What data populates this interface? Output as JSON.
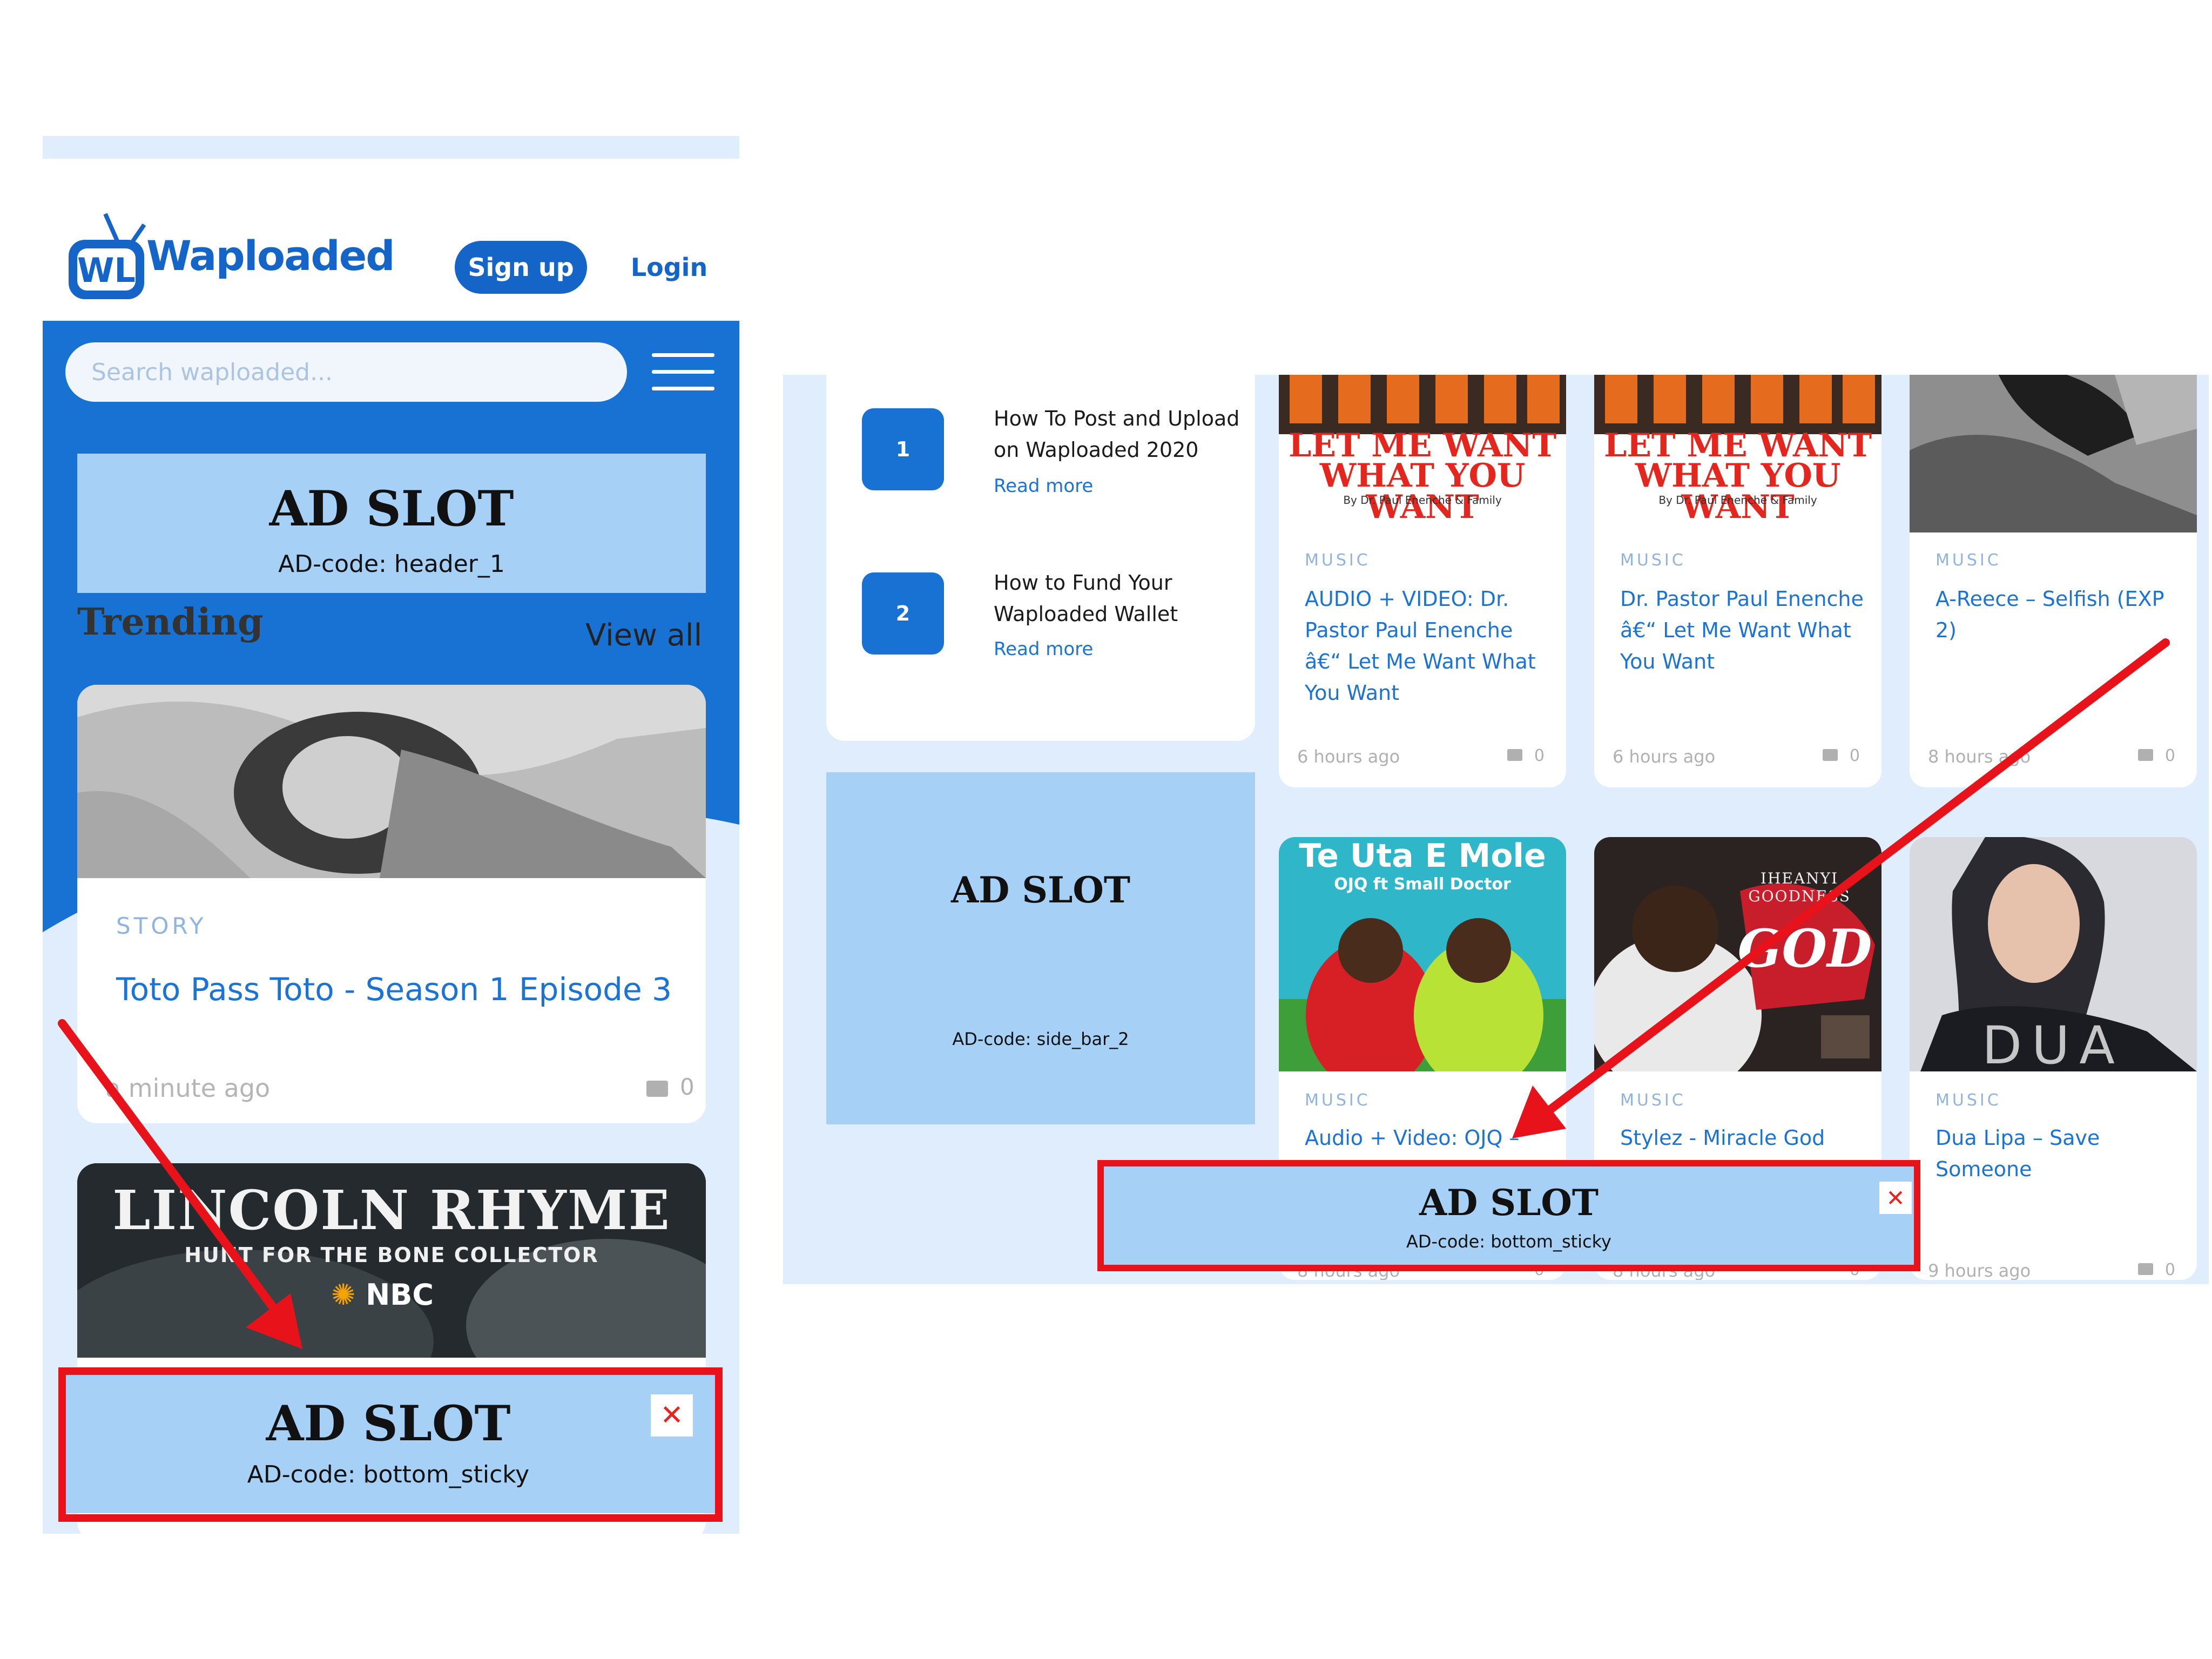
{
  "colors": {
    "brand_blue": "#1872d4",
    "panel_bg": "#dfedfc",
    "ad_blue": "#a6d0f5",
    "highlight_red": "#e8131a"
  },
  "mobile": {
    "logo_text": "Waploaded",
    "signup_label": "Sign up",
    "login_label": "Login",
    "search_placeholder": "Search waploaded...",
    "menu_icon": "hamburger-icon",
    "ad_header": {
      "title": "AD SLOT",
      "code": "AD-code: header_1"
    },
    "trending_label": "Trending",
    "view_all_label": "View all",
    "card1": {
      "category": "STORY",
      "title": "Toto Pass Toto - Season 1 Episode 3",
      "time": "a minute ago",
      "comments": "0"
    },
    "card2": {
      "poster_title": "LINCOLN RHYME",
      "poster_subtitle": "HUNT FOR THE BONE COLLECTOR",
      "poster_network": "NBC"
    },
    "ad_bottom": {
      "title": "AD SLOT",
      "code": "AD-code: bottom_sticky",
      "close": "✕"
    }
  },
  "desktop": {
    "list": [
      {
        "number": "1",
        "title": "How To Post and Upload on Waploaded 2020",
        "read_more": "Read more"
      },
      {
        "number": "2",
        "title": "How to Fund Your Waploaded Wallet",
        "read_more": "Read more"
      }
    ],
    "ad_side": {
      "title": "AD SLOT",
      "code": "AD-code: side_bar_2"
    },
    "posts": [
      {
        "category": "MUSIC",
        "title": "AUDIO + VIDEO: Dr. Pastor Paul Enenche â€“ Let Me Want What You Want",
        "time": "6 hours ago",
        "comments": "0",
        "poster_l1": "LET ME WANT",
        "poster_l2": "WHAT YOU WANT",
        "poster_by": "By Dr. Paul Enenche & Family"
      },
      {
        "category": "MUSIC",
        "title": "Dr. Pastor Paul Enenche â€“ Let Me Want What You Want",
        "time": "6 hours ago",
        "comments": "0",
        "poster_l1": "LET ME WANT",
        "poster_l2": "WHAT YOU WANT",
        "poster_by": "By Dr. Paul Enenche & Family"
      },
      {
        "category": "MUSIC",
        "title": "A-Reece – Selfish (EXP 2)",
        "time": "8 hours ago",
        "comments": "0"
      },
      {
        "category": "MUSIC",
        "title": "Audio + Video: OJQ –",
        "time": "8 hours ago",
        "comments": "0",
        "poster_l1": "Te Uta E Mole",
        "poster_l2": "OJQ ft Small Doctor"
      },
      {
        "category": "MUSIC",
        "title": "Stylez - Miracle God",
        "time": "8 hours ago",
        "comments": "0",
        "poster_l1": "IHEANYI GOODNESS",
        "poster_l2": "GOD"
      },
      {
        "category": "MUSIC",
        "title": "Dua Lipa – Save Someone",
        "time": "9 hours ago",
        "comments": "0",
        "poster_l1": "DUA LIPA"
      }
    ],
    "ad_bottom": {
      "title": "AD SLOT",
      "code": "AD-code: bottom_sticky",
      "close": "✕"
    }
  }
}
